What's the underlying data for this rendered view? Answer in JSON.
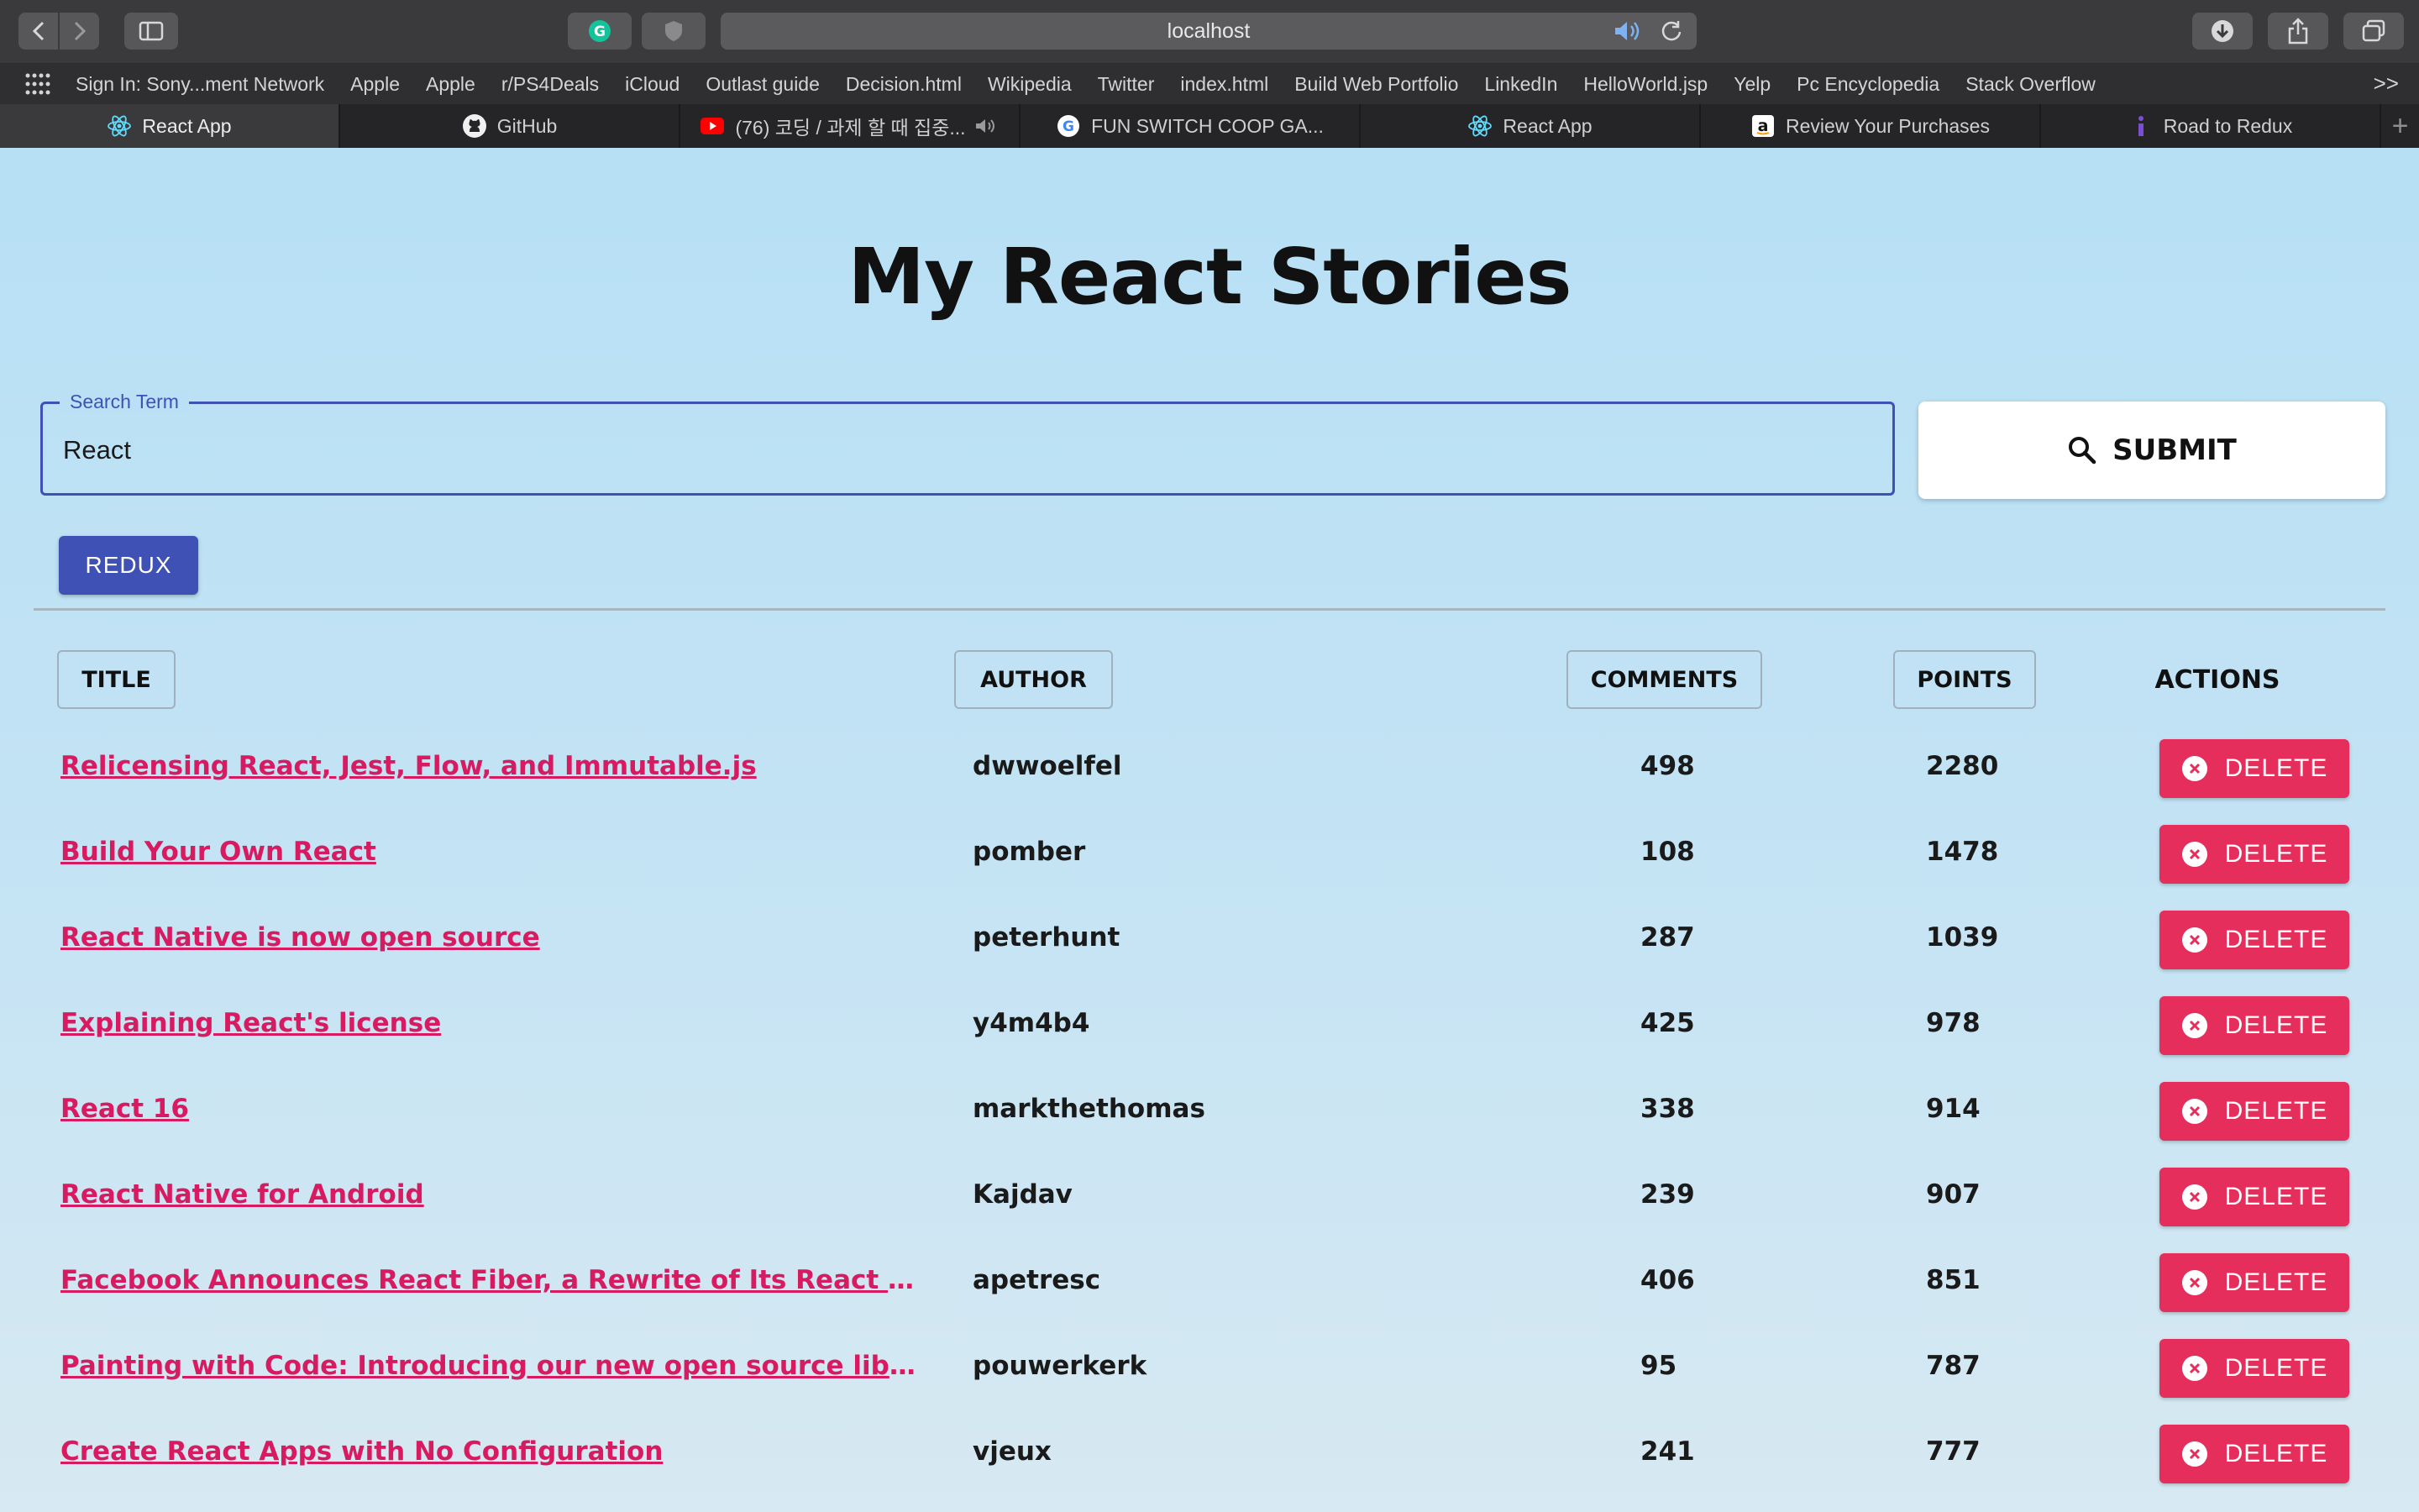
{
  "browser": {
    "url": "localhost",
    "bookmarks": [
      "Sign In: Sony...ment Network",
      "Apple",
      "Apple",
      "r/PS4Deals",
      "iCloud",
      "Outlast guide",
      "Decision.html",
      "Wikipedia",
      "Twitter",
      "index.html",
      "Build Web Portfolio",
      "LinkedIn",
      "HelloWorld.jsp",
      "Yelp",
      "Pc Encyclopedia",
      "Stack Overflow"
    ],
    "more_label": ">>",
    "tabs": [
      {
        "label": "React App",
        "icon": "react-icon",
        "active": true
      },
      {
        "label": "GitHub",
        "icon": "github-icon"
      },
      {
        "label": "(76) 코딩 / 과제 할 때 집중...",
        "icon": "youtube-icon"
      },
      {
        "label": "FUN SWITCH COOP GA...",
        "icon": "google-icon"
      },
      {
        "label": "React App",
        "icon": "react-icon"
      },
      {
        "label": "Review Your Purchases",
        "icon": "amazon-icon"
      },
      {
        "label": "Road to Redux",
        "icon": "info-icon"
      }
    ],
    "new_tab_label": "+"
  },
  "page": {
    "title": "My React Stories",
    "search": {
      "legend": "Search Term",
      "value": "React"
    },
    "submit_label": "SUBMIT",
    "redux_label": "REDUX",
    "columns": {
      "title": "TITLE",
      "author": "AUTHOR",
      "comments": "COMMENTS",
      "points": "POINTS",
      "actions": "ACTIONS"
    },
    "delete_label": "DELETE",
    "stories": [
      {
        "title": "Relicensing React, Jest, Flow, and Immutable.js",
        "author": "dwwoelfel",
        "comments": "498",
        "points": "2280"
      },
      {
        "title": "Build Your Own React",
        "author": "pomber",
        "comments": "108",
        "points": "1478"
      },
      {
        "title": "React Native is now open source",
        "author": "peterhunt",
        "comments": "287",
        "points": "1039"
      },
      {
        "title": "Explaining React's license",
        "author": "y4m4b4",
        "comments": "425",
        "points": "978"
      },
      {
        "title": "React 16",
        "author": "markthethomas",
        "comments": "338",
        "points": "914"
      },
      {
        "title": "React Native for Android",
        "author": "Kajdav",
        "comments": "239",
        "points": "907"
      },
      {
        "title": "Facebook Announces React Fiber, a Rewrite of Its React Framework",
        "author": "apetresc",
        "comments": "406",
        "points": "851"
      },
      {
        "title": "Painting with Code: Introducing our new open source library React Sk...",
        "author": "pouwerkerk",
        "comments": "95",
        "points": "787"
      },
      {
        "title": "Create React Apps with No Configuration",
        "author": "vjeux",
        "comments": "241",
        "points": "777"
      }
    ]
  },
  "colors": {
    "accent": "#3f51b5",
    "link": "#d81b60",
    "delete": "#e62e5c",
    "background": "#bfe3f6"
  }
}
